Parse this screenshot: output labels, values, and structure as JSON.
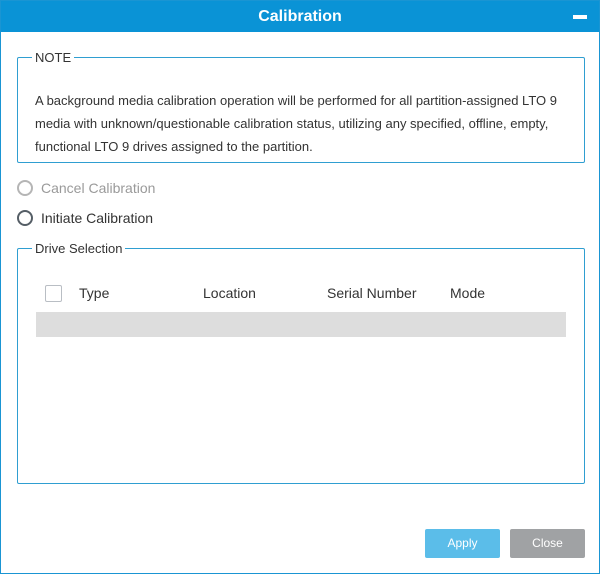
{
  "dialog": {
    "title": "Calibration",
    "minimize_icon": "minus-icon"
  },
  "note": {
    "legend": "NOTE",
    "text": "A background media calibration operation will be performed for all partition-assigned LTO 9 media with unknown/questionable calibration status, utilizing any specified, offline, empty, functional LTO 9 drives assigned to the partition."
  },
  "options": {
    "cancel_label": "Cancel Calibration",
    "cancel_enabled": false,
    "initiate_label": "Initiate Calibration",
    "initiate_selected": false
  },
  "drive_selection": {
    "legend": "Drive Selection",
    "columns": [
      "Type",
      "Location",
      "Serial Number",
      "Mode"
    ],
    "rows": []
  },
  "buttons": {
    "apply_label": "Apply",
    "close_label": "Close"
  },
  "colors": {
    "titlebar": "#0a93d6",
    "border": "#2f9ed1",
    "apply": "#5bbde9",
    "close": "#a0a2a4"
  }
}
